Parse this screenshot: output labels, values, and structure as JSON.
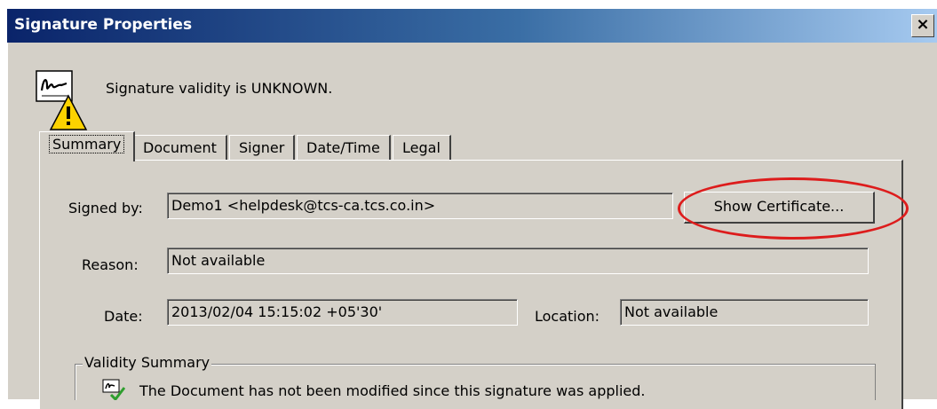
{
  "window": {
    "title": "Signature Properties",
    "close_label": "×"
  },
  "status": {
    "text": "Signature validity is UNKNOWN."
  },
  "tabs": [
    {
      "label": "Summary",
      "active": true
    },
    {
      "label": "Document"
    },
    {
      "label": "Signer"
    },
    {
      "label": "Date/Time"
    },
    {
      "label": "Legal"
    }
  ],
  "summary": {
    "signed_by_label": "Signed by:",
    "signed_by_value": "Demo1 <helpdesk@tcs-ca.tcs.co.in>",
    "show_cert_label": "Show Certificate...",
    "reason_label": "Reason:",
    "reason_value": "Not available",
    "date_label": "Date:",
    "date_value": "2013/02/04 15:15:02 +05'30'",
    "location_label": "Location:",
    "location_value": "Not available"
  },
  "validity": {
    "legend": "Validity Summary",
    "items": [
      {
        "text": "The Document has not been modified since this signature was applied.",
        "icon": "signed-document-check-icon"
      }
    ]
  },
  "colors": {
    "dialog_bg": "#d4d0c8",
    "titlebar_start": "#0a246a",
    "titlebar_end": "#a6caf0",
    "highlight_ellipse": "#dd1c1c"
  }
}
